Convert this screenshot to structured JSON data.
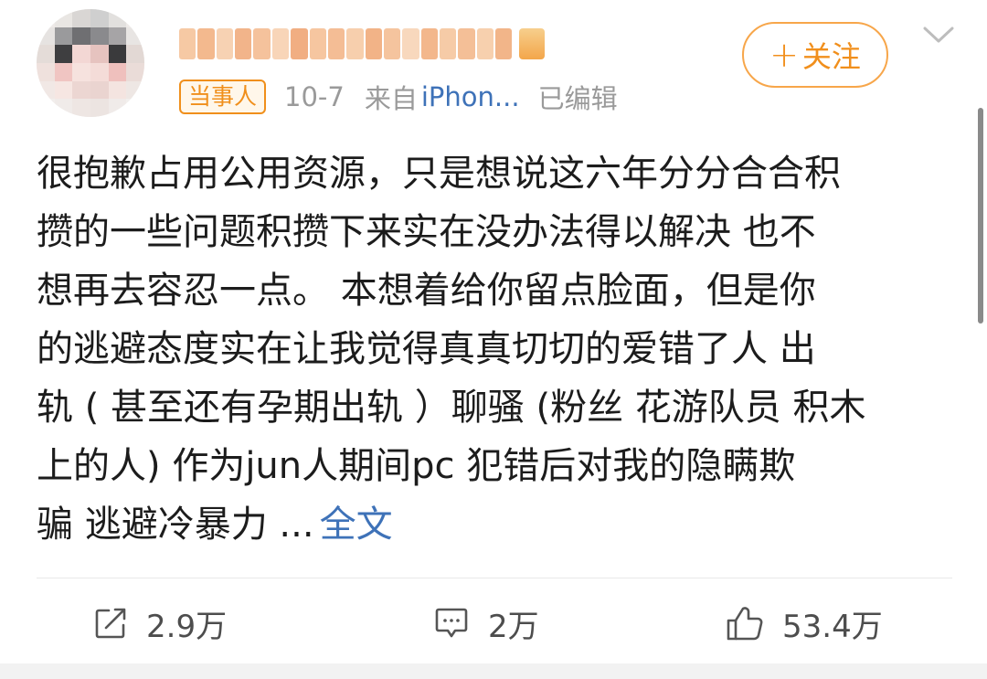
{
  "author": {
    "role_badge": "当事人"
  },
  "meta": {
    "date": "10-7",
    "from_label": "来自",
    "device": "iPhon...",
    "edited": "已编辑"
  },
  "follow": {
    "plus": "+",
    "label": "关注"
  },
  "post": {
    "lines": [
      "很抱歉占用公用资源，只是想说这六年分分合合积",
      "攒的一些问题积攒下来实在没办法得以解决 也不",
      "想再去容忍一点。 本想着给你留点脸面，但是你",
      "的逃避态度实在让我觉得真真切切的爱错了人  出",
      "轨 ( 甚至还有孕期出轨 ）聊骚 (粉丝 花游队员 积木",
      "上的人)  作为jun人期间pc  犯错后对我的隐瞒欺"
    ],
    "last_line": "骗 逃避冷暴力 ...",
    "full_text_link": "全文"
  },
  "actions": {
    "repost_count": "2.9万",
    "comment_count": "2万",
    "like_count": "53.4万"
  },
  "colors": {
    "accent_orange": "#f18f1c",
    "link_blue": "#3e72b8",
    "meta_gray": "#9a9a9a"
  },
  "icons": {
    "repost": "share-box-icon",
    "comment": "comment-bubble-icon",
    "like": "thumbs-up-icon",
    "menu": "chevron-down-icon"
  }
}
